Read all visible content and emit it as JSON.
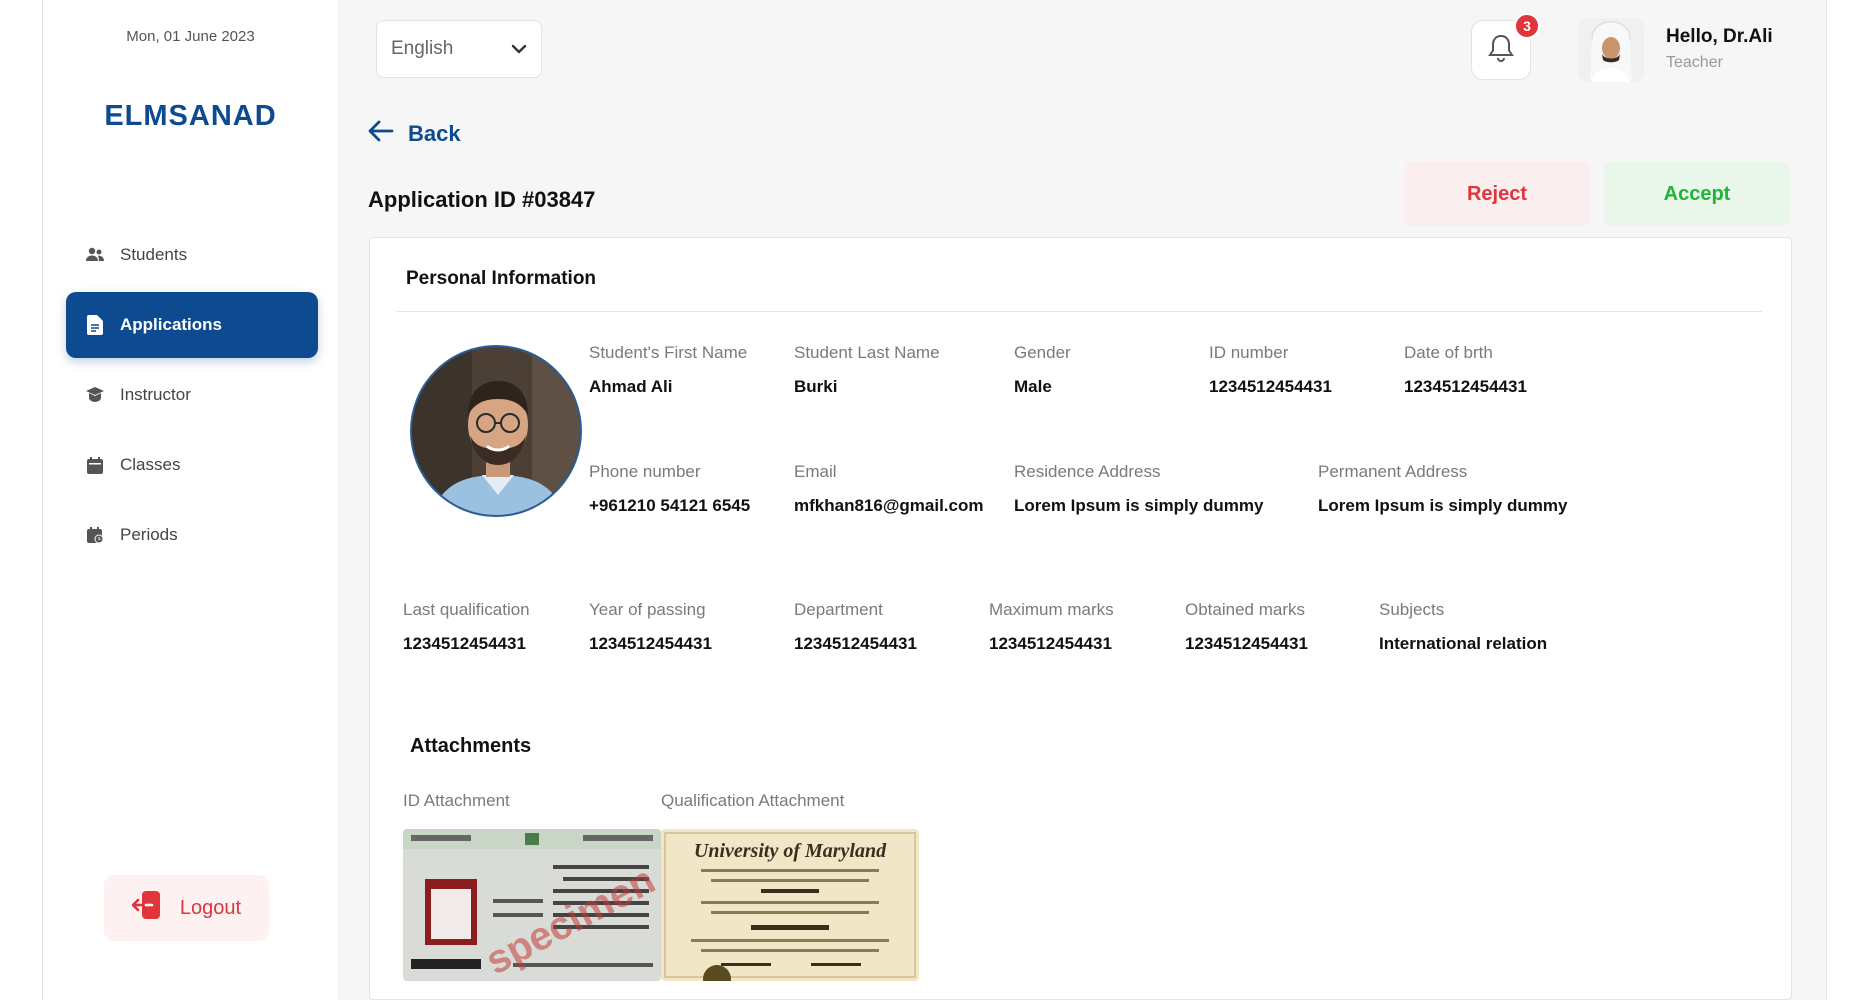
{
  "sidebar": {
    "date": "Mon, 01 June 2023",
    "logo": "ELMSANAD",
    "items": [
      {
        "label": "Students",
        "icon": "users-icon",
        "active": false
      },
      {
        "label": "Applications",
        "icon": "document-icon",
        "active": true
      },
      {
        "label": "Instructor",
        "icon": "instructor-icon",
        "active": false
      },
      {
        "label": "Classes",
        "icon": "calendar-icon",
        "active": false
      },
      {
        "label": "Periods",
        "icon": "calendar-clock-icon",
        "active": false
      }
    ],
    "logout_label": "Logout"
  },
  "header": {
    "language": "English",
    "notification_count": "3",
    "greeting": "Hello, Dr.Ali",
    "role": "Teacher"
  },
  "page": {
    "back_label": "Back",
    "title": "Application ID #03847",
    "reject_label": "Reject",
    "accept_label": "Accept"
  },
  "personal": {
    "title": "Personal Information",
    "first_name": {
      "label": "Student's First Name",
      "value": "Ahmad Ali"
    },
    "last_name": {
      "label": "Student Last Name",
      "value": "Burki"
    },
    "gender": {
      "label": "Gender",
      "value": "Male"
    },
    "id_number": {
      "label": "ID number",
      "value": "1234512454431"
    },
    "dob": {
      "label": "Date of brth",
      "value": "1234512454431"
    },
    "phone": {
      "label": "Phone number",
      "value": "+961210 54121 6545"
    },
    "email": {
      "label": "Email",
      "value": "mfkhan816@gmail.com"
    },
    "residence": {
      "label": "Residence Address",
      "value": "Lorem Ipsum is simply dummy"
    },
    "permanent": {
      "label": "Permanent Address",
      "value": "Lorem Ipsum is simply dummy"
    },
    "last_qualification": {
      "label": "Last qualification",
      "value": "1234512454431"
    },
    "year_passing": {
      "label": "Year of passing",
      "value": "1234512454431"
    },
    "department": {
      "label": "Department",
      "value": "1234512454431"
    },
    "max_marks": {
      "label": "Maximum marks",
      "value": "1234512454431"
    },
    "obtained_marks": {
      "label": "Obtained marks",
      "value": "1234512454431"
    },
    "subjects": {
      "label": "Subjects",
      "value": "International relation"
    }
  },
  "attachments": {
    "title": "Attachments",
    "id_label": "ID Attachment",
    "id_specimen": "specimen",
    "qualification_label": "Qualification Attachment",
    "qualification_header": "University of Maryland"
  },
  "colors": {
    "brand": "#0e4a8f",
    "reject": "#e0353b",
    "accept": "#22b33a"
  }
}
